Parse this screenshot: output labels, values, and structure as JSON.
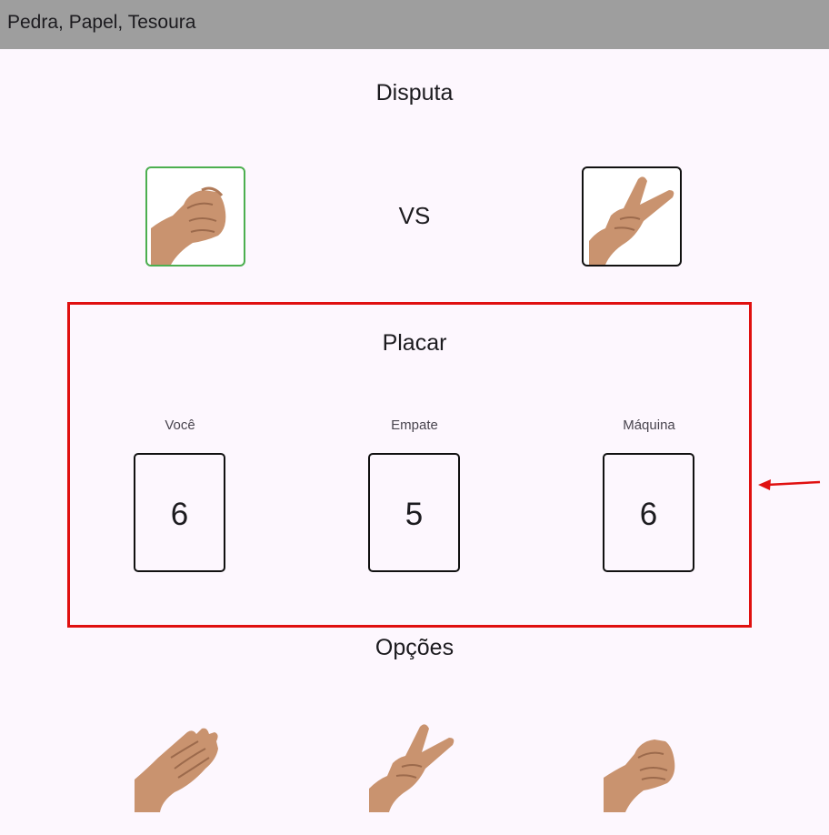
{
  "appbar": {
    "title": "Pedra, Papel, Tesoura"
  },
  "disputa": {
    "title": "Disputa",
    "player_choice_icon": "rock-hand-icon",
    "vs_label": "VS",
    "machine_choice_icon": "scissors-hand-icon",
    "player_border_color": "#4caf50",
    "machine_border_color": "#111111"
  },
  "placar": {
    "title": "Placar",
    "highlight_color": "#e01010",
    "you": {
      "label": "Você",
      "value": "6"
    },
    "tie": {
      "label": "Empate",
      "value": "5"
    },
    "machine": {
      "label": "Máquina",
      "value": "6"
    }
  },
  "opcoes": {
    "title": "Opções",
    "items": [
      {
        "icon": "paper-hand-icon"
      },
      {
        "icon": "scissors-hand-icon"
      },
      {
        "icon": "rock-hand-icon"
      }
    ]
  },
  "annotation": {
    "arrow_color": "#e01010"
  }
}
